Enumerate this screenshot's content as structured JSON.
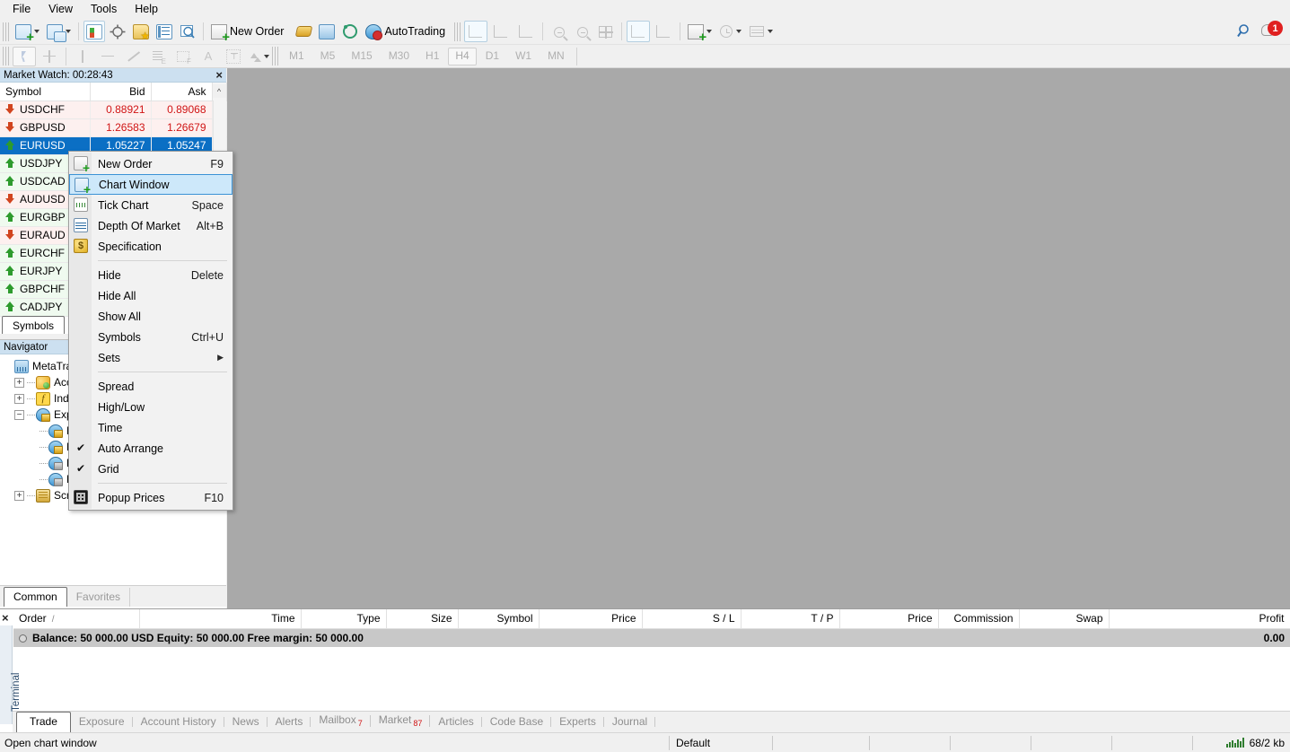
{
  "menubar": {
    "items": [
      "File",
      "View",
      "Tools",
      "Help"
    ]
  },
  "toolbar": {
    "new_order_label": "New Order",
    "autotrading_label": "AutoTrading",
    "icons": [
      "new-chart-icon",
      "tile-windows-icon",
      "market-watch-icon",
      "crosshair-icon",
      "favorites-icon",
      "navigator-icon",
      "data-window-icon"
    ],
    "right_icons": [
      "search-icon",
      "notifications-icon"
    ],
    "notification_count": "1"
  },
  "timeframes": {
    "items": [
      "M1",
      "M5",
      "M15",
      "M30",
      "H1",
      "H4",
      "D1",
      "W1",
      "MN"
    ],
    "active": "H4"
  },
  "market_watch": {
    "title": "Market Watch: 00:28:43",
    "columns": [
      "Symbol",
      "Bid",
      "Ask"
    ],
    "tab": "Symbols",
    "rows": [
      {
        "symbol": "USDCHF",
        "bid": "0.88921",
        "ask": "0.89068",
        "dir": "down",
        "selected": false
      },
      {
        "symbol": "GBPUSD",
        "bid": "1.26583",
        "ask": "1.26679",
        "dir": "down",
        "selected": false
      },
      {
        "symbol": "EURUSD",
        "bid": "1.05227",
        "ask": "1.05247",
        "dir": "up",
        "selected": true
      },
      {
        "symbol": "USDJPY",
        "bid": "",
        "ask": "",
        "dir": "up",
        "selected": false
      },
      {
        "symbol": "USDCAD",
        "bid": "",
        "ask": "",
        "dir": "up",
        "selected": false
      },
      {
        "symbol": "AUDUSD",
        "bid": "",
        "ask": "",
        "dir": "down",
        "selected": false
      },
      {
        "symbol": "EURGBP",
        "bid": "",
        "ask": "",
        "dir": "up",
        "selected": false
      },
      {
        "symbol": "EURAUD",
        "bid": "",
        "ask": "",
        "dir": "down",
        "selected": false
      },
      {
        "symbol": "EURCHF",
        "bid": "",
        "ask": "",
        "dir": "up",
        "selected": false
      },
      {
        "symbol": "EURJPY",
        "bid": "",
        "ask": "",
        "dir": "up",
        "selected": false
      },
      {
        "symbol": "GBPCHF",
        "bid": "",
        "ask": "",
        "dir": "up",
        "selected": false
      },
      {
        "symbol": "CADJPY",
        "bid": "",
        "ask": "",
        "dir": "up",
        "selected": false
      }
    ]
  },
  "context_menu": {
    "items": [
      {
        "label": "New Order",
        "accel": "F9",
        "icon": "new-order-icon",
        "highlighted": false,
        "checked": false,
        "submenu": false
      },
      {
        "label": "Chart Window",
        "accel": "",
        "icon": "chart-window-icon",
        "highlighted": true,
        "checked": false,
        "submenu": false
      },
      {
        "label": "Tick Chart",
        "accel": "Space",
        "icon": "tick-chart-icon",
        "highlighted": false,
        "checked": false,
        "submenu": false
      },
      {
        "label": "Depth Of Market",
        "accel": "Alt+B",
        "icon": "depth-of-market-icon",
        "highlighted": false,
        "checked": false,
        "submenu": false
      },
      {
        "label": "Specification",
        "accel": "",
        "icon": "specification-icon",
        "highlighted": false,
        "checked": false,
        "submenu": false
      },
      {
        "separator": true
      },
      {
        "label": "Hide",
        "accel": "Delete",
        "icon": "",
        "highlighted": false,
        "checked": false,
        "submenu": false
      },
      {
        "label": "Hide All",
        "accel": "",
        "icon": "",
        "highlighted": false,
        "checked": false,
        "submenu": false
      },
      {
        "label": "Show All",
        "accel": "",
        "icon": "",
        "highlighted": false,
        "checked": false,
        "submenu": false
      },
      {
        "label": "Symbols",
        "accel": "Ctrl+U",
        "icon": "",
        "highlighted": false,
        "checked": false,
        "submenu": false
      },
      {
        "label": "Sets",
        "accel": "",
        "icon": "",
        "highlighted": false,
        "checked": false,
        "submenu": true
      },
      {
        "separator": true
      },
      {
        "label": "Spread",
        "accel": "",
        "icon": "",
        "highlighted": false,
        "checked": false,
        "submenu": false
      },
      {
        "label": "High/Low",
        "accel": "",
        "icon": "",
        "highlighted": false,
        "checked": false,
        "submenu": false
      },
      {
        "label": "Time",
        "accel": "",
        "icon": "",
        "highlighted": false,
        "checked": false,
        "submenu": false
      },
      {
        "label": "Auto Arrange",
        "accel": "",
        "icon": "",
        "highlighted": false,
        "checked": true,
        "submenu": false
      },
      {
        "label": "Grid",
        "accel": "",
        "icon": "",
        "highlighted": false,
        "checked": true,
        "submenu": false
      },
      {
        "separator": true
      },
      {
        "label": "Popup Prices",
        "accel": "F10",
        "icon": "popup-prices-icon",
        "highlighted": false,
        "checked": false,
        "submenu": false
      }
    ]
  },
  "navigator": {
    "title": "Navigator",
    "nodes": [
      {
        "label": "MetaTrader",
        "icon": "metatrader-icon",
        "depth": 0,
        "state": "none"
      },
      {
        "label": "Accounts",
        "icon": "accounts-icon",
        "depth": 1,
        "state": "collapsed"
      },
      {
        "label": "Indicators",
        "icon": "indicators-icon",
        "depth": 1,
        "state": "collapsed"
      },
      {
        "label": "Experts",
        "icon": "experts-icon",
        "depth": 1,
        "state": "expanded"
      },
      {
        "label": "M",
        "icon": "expert-icon",
        "depth": 2,
        "state": "leaf"
      },
      {
        "label": "M",
        "icon": "expert-icon",
        "depth": 2,
        "state": "leaf"
      },
      {
        "label": "R",
        "icon": "expert-gray-icon",
        "depth": 2,
        "state": "leaf"
      },
      {
        "label": "R",
        "icon": "expert-gray-icon",
        "depth": 2,
        "state": "leaf"
      },
      {
        "label": "Scripts",
        "icon": "scripts-icon",
        "depth": 1,
        "state": "collapsed"
      }
    ],
    "tabs": [
      {
        "label": "Common",
        "active": true
      },
      {
        "label": "Favorites",
        "active": false
      }
    ]
  },
  "terminal": {
    "panel_label": "Terminal",
    "columns": [
      "Order",
      "Time",
      "Type",
      "Size",
      "Symbol",
      "Price",
      "S / L",
      "T / P",
      "Price",
      "Commission",
      "Swap",
      "Profit"
    ],
    "sort_marker": "/",
    "balance_line": "Balance: 50 000.00 USD  Equity: 50 000.00  Free margin: 50 000.00",
    "total_profit": "0.00",
    "tabs": [
      {
        "label": "Trade",
        "badge": "",
        "active": true
      },
      {
        "label": "Exposure",
        "badge": "",
        "active": false
      },
      {
        "label": "Account History",
        "badge": "",
        "active": false
      },
      {
        "label": "News",
        "badge": "",
        "active": false
      },
      {
        "label": "Alerts",
        "badge": "",
        "active": false
      },
      {
        "label": "Mailbox",
        "badge": "7",
        "active": false
      },
      {
        "label": "Market",
        "badge": "87",
        "active": false
      },
      {
        "label": "Articles",
        "badge": "",
        "active": false
      },
      {
        "label": "Code Base",
        "badge": "",
        "active": false
      },
      {
        "label": "Experts",
        "badge": "",
        "active": false
      },
      {
        "label": "Journal",
        "badge": "",
        "active": false
      }
    ]
  },
  "status_bar": {
    "message": "Open chart window",
    "profile": "Default",
    "traffic": "68/2 kb"
  },
  "colors": {
    "accent": "#0b6fc4",
    "price_red": "#d01414",
    "up_green": "#2d9b2d",
    "down_red": "#d1441f",
    "badge_red": "#e02020",
    "chart_bg": "#a9a9a9",
    "panel_title": "#cce0f0"
  }
}
